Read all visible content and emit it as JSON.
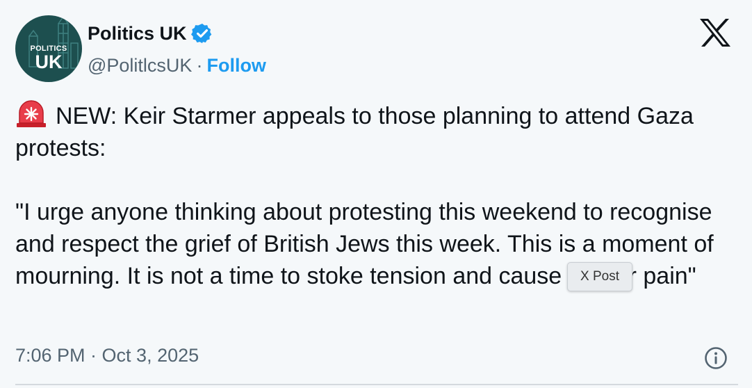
{
  "author": {
    "display_name": "Politics UK",
    "handle": "@PolitlcsUK",
    "separator": "·",
    "follow_label": "Follow",
    "avatar": {
      "line1": "POLITICS",
      "line2": "UK"
    },
    "verified_icon": "verified-badge-icon"
  },
  "tweet": {
    "paragraph1": "NEW: Keir Starmer appeals to those planning to attend Gaza protests:",
    "paragraph2": "\"I urge anyone thinking about protesting this weekend to recognise and respect the grief of British Jews this week. This is a moment of mourning. It is not a time to stoke tension and cause further pain\"",
    "leading_emoji": "siren-icon"
  },
  "tooltip": {
    "label": "X Post"
  },
  "timestamp": "7:06 PM · Oct 3, 2025",
  "icons": {
    "platform": "x-logo-icon",
    "info": "info-icon"
  },
  "colors": {
    "accent": "#1d9bf0",
    "background": "#f5f8fa",
    "secondary_text": "#536471",
    "avatar_bg": "#1d4f4f"
  }
}
